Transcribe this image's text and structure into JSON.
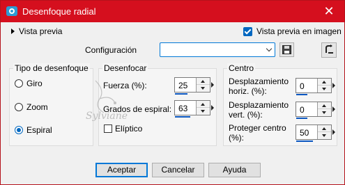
{
  "window": {
    "title": "Desenfoque radial",
    "close_glyph": "✕"
  },
  "top": {
    "preview_toggle_label": "Vista previa",
    "preview_in_image_label": "Vista previa en imagen",
    "preview_in_image_checked": true
  },
  "config": {
    "label": "Configuración",
    "value": ""
  },
  "blur_type": {
    "title": "Tipo de desenfoque",
    "options": [
      {
        "label": "Giro",
        "selected": false
      },
      {
        "label": "Zoom",
        "selected": false
      },
      {
        "label": "Espiral",
        "selected": true
      }
    ]
  },
  "blur": {
    "title": "Desenfocar",
    "strength_label": "Fuerza (%):",
    "strength_value": "25",
    "spiral_label": "Grados de espiral:",
    "spiral_value": "63",
    "elliptic_label": "Elíptico",
    "elliptic_checked": false
  },
  "center": {
    "title": "Centro",
    "hoff_label_1": "Desplazamiento",
    "hoff_label_2": "horiz. (%):",
    "hoff_value": "0",
    "voff_label_1": "Desplazamiento",
    "voff_label_2": "vert. (%):",
    "voff_value": "0",
    "protect_label_1": "Proteger centro",
    "protect_label_2": "(%):",
    "protect_value": "50"
  },
  "footer": {
    "ok": "Aceptar",
    "cancel": "Cancelar",
    "help": "Ayuda"
  },
  "watermark": {
    "text": "Sylviane"
  },
  "colors": {
    "titlebar": "#d50f1e",
    "accent": "#0067c0",
    "slider": "#0a56c0"
  }
}
